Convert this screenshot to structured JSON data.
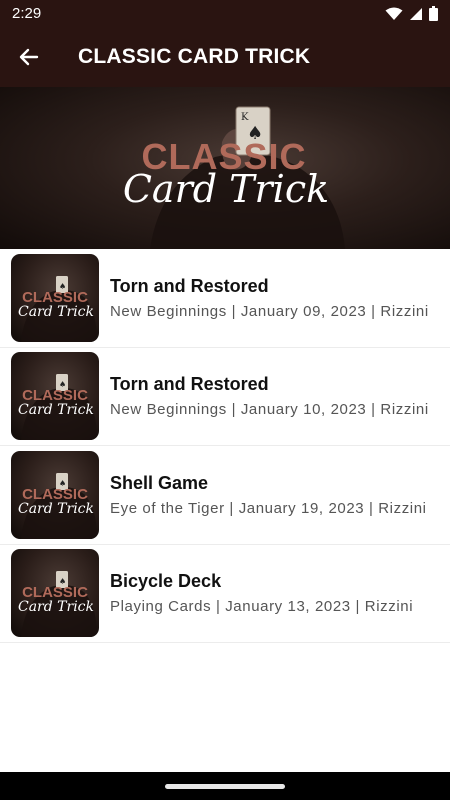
{
  "status_bar": {
    "time": "2:29",
    "icons": [
      "wifi-icon",
      "signal-icon",
      "battery-icon"
    ]
  },
  "app_bar": {
    "back_icon": "arrow-left-icon",
    "title": "CLASSIC CARD TRICK"
  },
  "hero": {
    "logo_line1": "CLASSIC",
    "logo_line2": "Card Trick"
  },
  "thumbnail": {
    "logo_line1": "CLASSIC",
    "logo_line2": "Card Trick"
  },
  "episodes": [
    {
      "title": "Torn and Restored",
      "subtitle": "New Beginnings  | January 09, 2023 |  Rizzini"
    },
    {
      "title": "Torn and Restored",
      "subtitle": "New Beginnings  | January 10, 2023 |  Rizzini"
    },
    {
      "title": "Shell Game",
      "subtitle": "Eye of the Tiger | January 19, 2023 |  Rizzini"
    },
    {
      "title": "Bicycle Deck",
      "subtitle": "Playing Cards | January 13, 2023 |  Rizzini"
    }
  ],
  "colors": {
    "app_bar_bg": "#2a1411",
    "logo_classic": "#b06a5a",
    "logo_script": "#ffffff"
  }
}
